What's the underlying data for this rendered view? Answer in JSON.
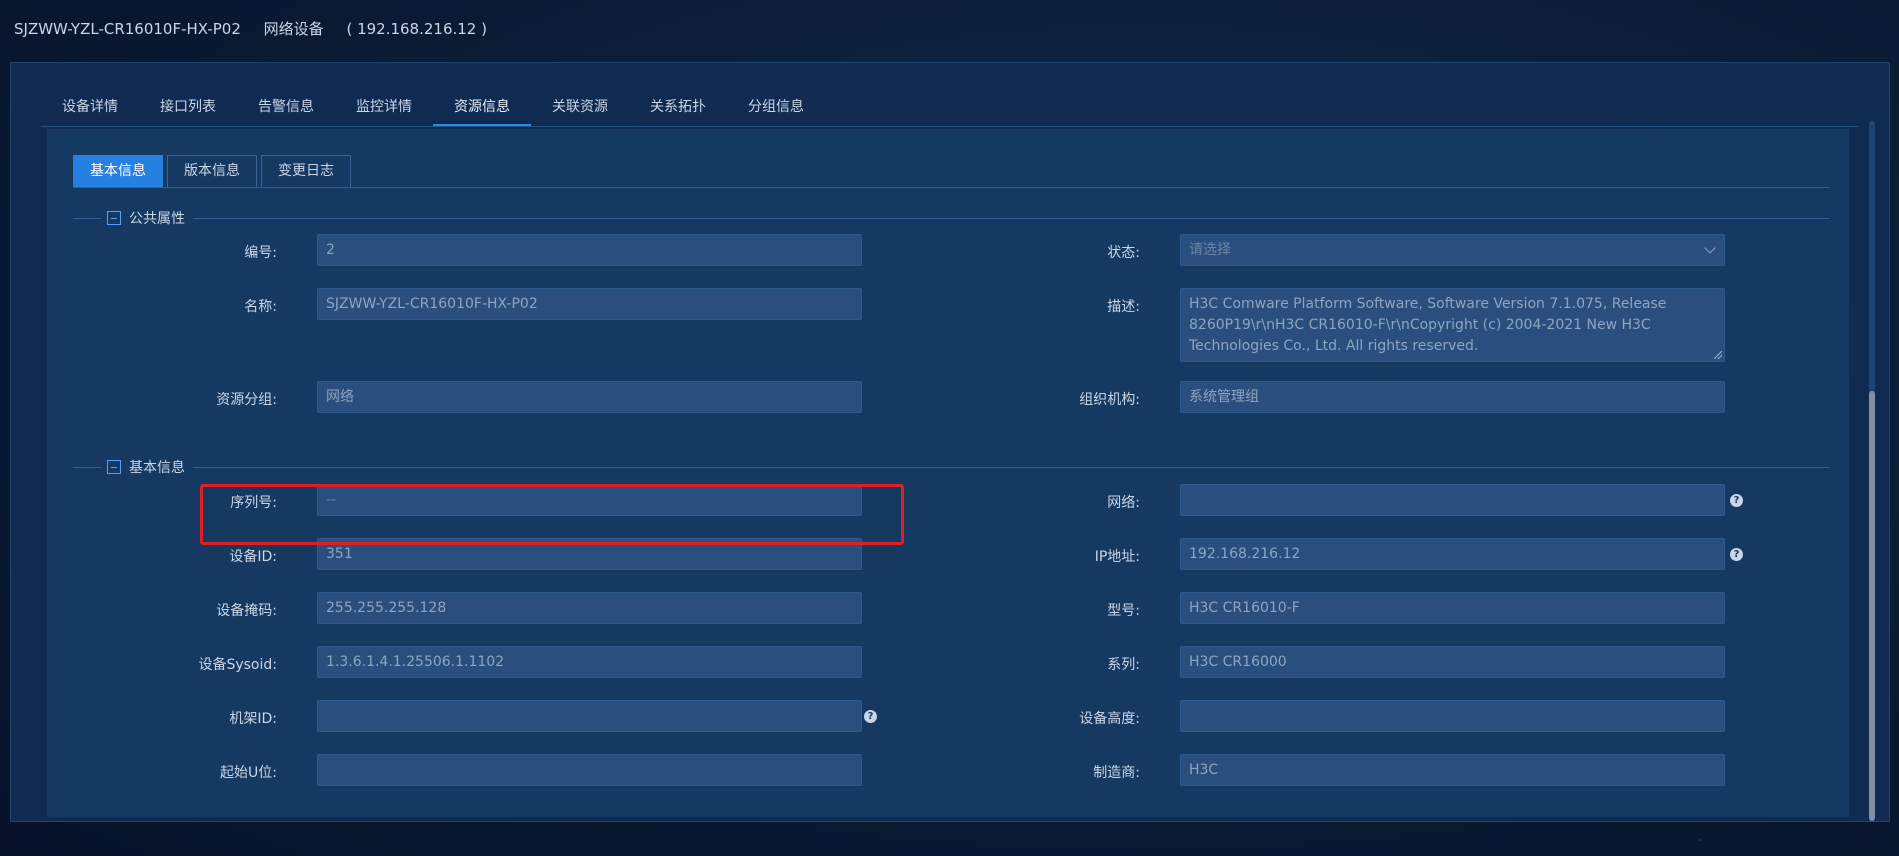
{
  "header": {
    "device_name": "SJZWW-YZL-CR16010F-HX-P02",
    "device_type": "网络设备",
    "ip": "( 192.168.216.12 )"
  },
  "tabs": [
    "设备详情",
    "接口列表",
    "告警信息",
    "监控详情",
    "资源信息",
    "关联资源",
    "关系拓扑",
    "分组信息"
  ],
  "active_tab": "资源信息",
  "subtabs": [
    "基本信息",
    "版本信息",
    "变更日志"
  ],
  "active_subtab": "基本信息",
  "sections": {
    "public": "公共属性",
    "basic": "基本信息"
  },
  "fields": {
    "number": {
      "label": "编号:",
      "value": "2"
    },
    "status": {
      "label": "状态:",
      "placeholder": "请选择"
    },
    "name": {
      "label": "名称:",
      "value": "SJZWW-YZL-CR16010F-HX-P02"
    },
    "description": {
      "label": "描述:",
      "value": "H3C Comware Platform Software, Software Version 7.1.075, Release 8260P19\\r\\nH3C CR16010-F\\r\\nCopyright (c) 2004-2021 New H3C Technologies Co., Ltd. All rights reserved."
    },
    "resource_group": {
      "label": "资源分组:",
      "value": "网络"
    },
    "organization": {
      "label": "组织机构:",
      "value": "系统管理组"
    },
    "serial": {
      "label": "序列号:",
      "value": "--"
    },
    "network": {
      "label": "网络:",
      "value": ""
    },
    "device_id": {
      "label": "设备ID:",
      "value": "351"
    },
    "ip_address": {
      "label": "IP地址:",
      "value": "192.168.216.12"
    },
    "mask": {
      "label": "设备掩码:",
      "value": "255.255.255.128"
    },
    "model": {
      "label": "型号:",
      "value": "H3C CR16010-F"
    },
    "sysoid": {
      "label": "设备Sysoid:",
      "value": "1.3.6.1.4.1.25506.1.1102"
    },
    "series": {
      "label": "系列:",
      "value": "H3C CR16000"
    },
    "rack_id": {
      "label": "机架ID:",
      "value": ""
    },
    "height": {
      "label": "设备高度:",
      "value": ""
    },
    "start_u": {
      "label": "起始U位:",
      "value": ""
    },
    "manufacturer": {
      "label": "制造商:",
      "value": "H3C"
    }
  },
  "help_glyph": "?",
  "colors": {
    "accent": "#2680e0",
    "highlight": "#e02020"
  }
}
